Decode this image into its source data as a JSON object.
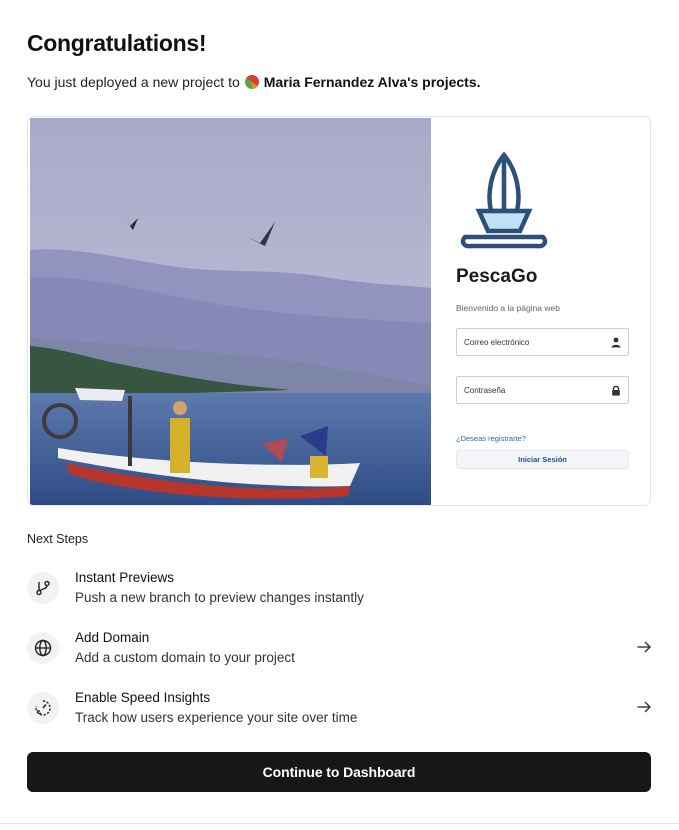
{
  "header": {
    "title": "Congratulations!",
    "subtitle_prefix": "You just deployed a new project to",
    "owner": "Maria Fernandez Alva's projects."
  },
  "preview": {
    "brand": "PescaGo",
    "welcome": "Bienvenido a la página web",
    "email_placeholder": "Correo electrónico",
    "password_placeholder": "Contraseña",
    "register_link": "¿Deseas registrarte?",
    "signin_button": "Iniciar Sesión",
    "accent_color": "#2d4f78"
  },
  "next_steps": {
    "title": "Next Steps",
    "items": [
      {
        "title": "Instant Previews",
        "description": "Push a new branch to preview changes instantly",
        "icon": "git-branch-icon"
      },
      {
        "title": "Add Domain",
        "description": "Add a custom domain to your project",
        "icon": "globe-icon"
      },
      {
        "title": "Enable Speed Insights",
        "description": "Track how users experience your site over time",
        "icon": "speed-gauge-icon"
      }
    ]
  },
  "cta": {
    "label": "Continue to Dashboard"
  }
}
